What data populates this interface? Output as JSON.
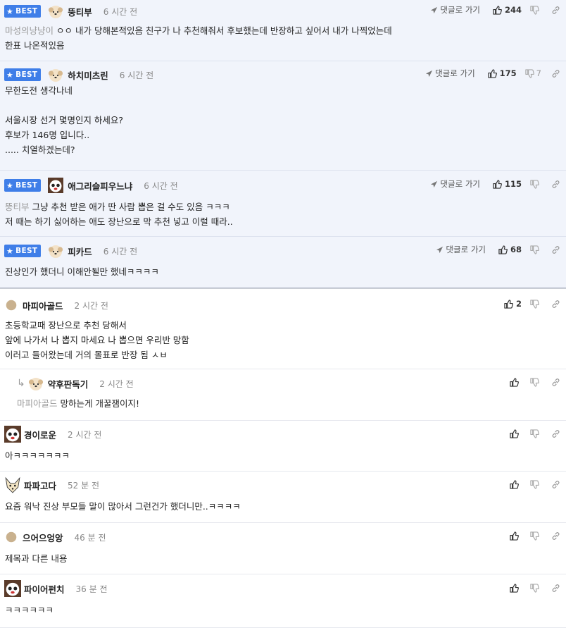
{
  "labels": {
    "best": "BEST",
    "reply_to": "댓글로 가기"
  },
  "comments": [
    {
      "nick": "뚱티부",
      "time": "6 시간 전",
      "likes": "244",
      "dislikes": "",
      "mention": "마성의냥냥이",
      "lines": "ㅇㅇ 내가 당해본적있음 친구가 나 추천해줘서 후보했는데 반장하고 싶어서 내가 나찍었는데\n한표 나온적있음"
    },
    {
      "nick": "하치미츠린",
      "time": "6 시간 전",
      "likes": "175",
      "dislikes": "7",
      "mention": "",
      "lines": "무한도전 생각나네\n\n서울시장 선거 몇명인지 하세요?\n후보가 146명 입니다..\n..... 치열하겠는데?"
    },
    {
      "nick": "애그리슬피우느냐",
      "time": "6 시간 전",
      "likes": "115",
      "dislikes": "",
      "mention": "뚱티부",
      "lines": "그냥 추천 받은 애가 딴 사람 뽑은 걸 수도 있음 ㅋㅋㅋ\n저 때는 하기 싫어하는 애도 장난으로 막 추천 넣고 이럴 때라.."
    },
    {
      "nick": "피카드",
      "time": "6 시간 전",
      "likes": "68",
      "dislikes": "",
      "mention": "",
      "lines": "진상인가 했더니 이해안될만 했네ㅋㅋㅋㅋ"
    },
    {
      "nick": "마피아골드",
      "time": "2 시간 전",
      "likes": "2",
      "dislikes": "",
      "mention": "",
      "lines": "초등학교때 장난으로 추천 당해서\n앞에 나가서 나 뽑지 마세요 나 뽑으면 우리반 망함\n이러고 들어왔는데 거의 몰표로 반장 됨 ㅅㅂ"
    },
    {
      "nick": "약후판독기",
      "time": "2 시간 전",
      "likes": "",
      "dislikes": "",
      "mention": "마피아골드",
      "lines": "망하는게 개꿀잼이지!"
    },
    {
      "nick": "경이로운",
      "time": "2 시간 전",
      "likes": "",
      "dislikes": "",
      "mention": "",
      "lines": "아ㅋㅋㅋㅋㅋㅋㅋ"
    },
    {
      "nick": "파파고다",
      "time": "52 분 전",
      "likes": "",
      "dislikes": "",
      "mention": "",
      "lines": "요즘 워낙 진상 부모들 말이 많아서 그런건가 했더니만..ㅋㅋㅋㅋ"
    },
    {
      "nick": "으어으엉앙",
      "time": "46 분 전",
      "likes": "",
      "dislikes": "",
      "mention": "",
      "lines": "제목과 다른 내용"
    },
    {
      "nick": "파이어펀치",
      "time": "36 분 전",
      "likes": "",
      "dislikes": "",
      "mention": "",
      "lines": "ㅋㅋㅋㅋㅋㅋ"
    }
  ]
}
